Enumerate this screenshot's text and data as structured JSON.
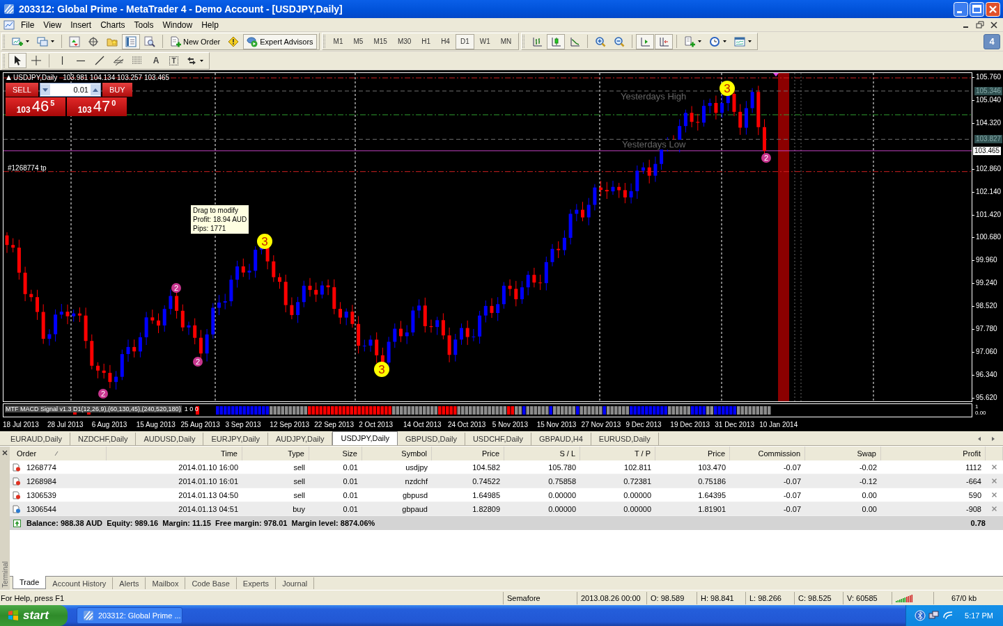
{
  "window": {
    "title": "203312: Global Prime - MetaTrader 4 - Demo Account - [USDJPY,Daily]"
  },
  "menu": [
    "File",
    "View",
    "Insert",
    "Charts",
    "Tools",
    "Window",
    "Help"
  ],
  "toolbar": {
    "main": [
      [
        {
          "kind": "new-chart",
          "pressed": false
        },
        {
          "kind": "profiles",
          "pressed": false
        }
      ],
      [
        {
          "kind": "market-watch",
          "pressed": false
        },
        {
          "kind": "data-window",
          "pressed": false
        },
        {
          "kind": "navigator",
          "pressed": false
        },
        {
          "kind": "terminal",
          "pressed": true
        },
        {
          "kind": "tester",
          "pressed": false
        }
      ],
      [
        {
          "kind": "new-order",
          "label": "New Order",
          "pressed": false
        },
        {
          "kind": "alert",
          "pressed": false
        },
        {
          "kind": "expert-advisors",
          "label": "Expert Advisors",
          "pressed": true
        }
      ]
    ],
    "timeframes": [
      {
        "label": "M1",
        "selected": false
      },
      {
        "label": "M5",
        "selected": false
      },
      {
        "label": "M15",
        "selected": false
      },
      {
        "label": "M30",
        "selected": false
      },
      {
        "label": "H1",
        "selected": false
      },
      {
        "label": "H4",
        "selected": false
      },
      {
        "label": "D1",
        "selected": true
      },
      {
        "label": "W1",
        "selected": false
      },
      {
        "label": "MN",
        "selected": false
      }
    ],
    "chart": [
      [
        {
          "kind": "bar-chart",
          "pressed": false
        },
        {
          "kind": "candles",
          "pressed": true
        },
        {
          "kind": "line-chart",
          "pressed": false
        }
      ],
      [
        {
          "kind": "zoom-in",
          "pressed": false
        },
        {
          "kind": "zoom-out",
          "pressed": false
        }
      ],
      [
        {
          "kind": "autoscroll",
          "pressed": true
        },
        {
          "kind": "chart-shift",
          "pressed": true
        }
      ],
      [
        {
          "kind": "indicators",
          "pressed": false
        },
        {
          "kind": "periods",
          "pressed": false
        },
        {
          "kind": "templates",
          "pressed": false
        }
      ]
    ],
    "drawing": [
      [
        {
          "kind": "cursor",
          "pressed": true
        },
        {
          "kind": "crosshair",
          "pressed": false
        }
      ],
      [
        {
          "kind": "vline",
          "pressed": false
        },
        {
          "kind": "hline",
          "pressed": false
        },
        {
          "kind": "trendline",
          "pressed": false
        },
        {
          "kind": "channel",
          "pressed": false
        },
        {
          "kind": "fibo",
          "pressed": false
        },
        {
          "kind": "text-tool",
          "label": "A",
          "pressed": false
        },
        {
          "kind": "label-tool",
          "label": "T",
          "pressed": false
        },
        {
          "kind": "arrows",
          "pressed": false
        }
      ]
    ]
  },
  "notifications": {
    "count": "4"
  },
  "chart": {
    "symbol": "USDJPY,Daily",
    "ohlc": "103.981 104.134 103.257 103.465",
    "one_click": {
      "sell": "SELL",
      "buy": "BUY",
      "lot": "0.01",
      "bid": {
        "prefix": "103",
        "big": "46",
        "sup": "5"
      },
      "ask": {
        "prefix": "103",
        "big": "47",
        "sup": "0"
      }
    },
    "order_label": "#1268774 tp",
    "tooltip": [
      "Drag to modify",
      "Profit: 18.94 AUD",
      "Pips: 1771"
    ],
    "level_labels": [
      "Yesterdays High",
      "Yesterdays Low"
    ],
    "markers": [
      {
        "label": "2",
        "kind": "minor",
        "color": "#c8358f"
      },
      {
        "label": "2",
        "kind": "minor",
        "color": "#c8358f"
      },
      {
        "label": "2",
        "kind": "minor",
        "color": "#c8358f"
      },
      {
        "label": "3",
        "kind": "major",
        "color": "#ffff00"
      },
      {
        "label": "3",
        "kind": "major",
        "color": "#ffff00"
      },
      {
        "label": "3",
        "kind": "major",
        "color": "#ffff00"
      },
      {
        "label": "2",
        "kind": "minor",
        "color": "#c8358f"
      }
    ],
    "price_ticks": [
      "105.760",
      "105.040",
      "104.320",
      "102.860",
      "102.140",
      "101.420",
      "100.680",
      "99.960",
      "99.240",
      "98.520",
      "97.780",
      "97.060",
      "96.340",
      "95.620"
    ],
    "price_tags": [
      {
        "label": "105.346",
        "kind": "level"
      },
      {
        "label": "103.827",
        "kind": "level"
      },
      {
        "label": "103.465",
        "kind": "bid"
      }
    ],
    "indicator": {
      "name": "MTF MACD Signal v1.3 D1(12,26,9),(60,130,45),(240,520,180)",
      "values": "1 0 0",
      "scale": [
        "1",
        "0.00"
      ]
    },
    "dates": [
      "18 Jul 2013",
      "28 Jul 2013",
      "6 Aug 2013",
      "15 Aug 2013",
      "25 Aug 2013",
      "3 Sep 2013",
      "12 Sep 2013",
      "22 Sep 2013",
      "2 Oct 2013",
      "14 Oct 2013",
      "24 Oct 2013",
      "5 Nov 2013",
      "15 Nov 2013",
      "27 Nov 2013",
      "9 Dec 2013",
      "19 Dec 2013",
      "31 Dec 2013",
      "10 Jan 2014"
    ]
  },
  "chart_tabs": [
    {
      "label": "EURAUD,Daily",
      "selected": false
    },
    {
      "label": "NZDCHF,Daily",
      "selected": false
    },
    {
      "label": "AUDUSD,Daily",
      "selected": false
    },
    {
      "label": "EURJPY,Daily",
      "selected": false
    },
    {
      "label": "AUDJPY,Daily",
      "selected": false
    },
    {
      "label": "USDJPY,Daily",
      "selected": true
    },
    {
      "label": "GBPUSD,Daily",
      "selected": false
    },
    {
      "label": "USDCHF,Daily",
      "selected": false
    },
    {
      "label": "GBPAUD,H4",
      "selected": false
    },
    {
      "label": "EURUSD,Daily",
      "selected": false
    }
  ],
  "terminal": {
    "label": "Terminal",
    "columns": [
      "Order",
      "Time",
      "Type",
      "Size",
      "Symbol",
      "Price",
      "S / L",
      "T / P",
      "Price",
      "Commission",
      "Swap",
      "Profit"
    ],
    "rows": [
      {
        "kind": "sell",
        "cells": [
          "1268774",
          "2014.01.10 16:00",
          "sell",
          "0.01",
          "usdjpy",
          "104.582",
          "105.780",
          "102.811",
          "103.470",
          "-0.07",
          "-0.02",
          "1112"
        ]
      },
      {
        "kind": "sell",
        "cells": [
          "1268984",
          "2014.01.10 16:01",
          "sell",
          "0.01",
          "nzdchf",
          "0.74522",
          "0.75858",
          "0.72381",
          "0.75186",
          "-0.07",
          "-0.12",
          "-664"
        ]
      },
      {
        "kind": "sell",
        "cells": [
          "1306539",
          "2014.01.13 04:50",
          "sell",
          "0.01",
          "gbpusd",
          "1.64985",
          "0.00000",
          "0.00000",
          "1.64395",
          "-0.07",
          "0.00",
          "590"
        ]
      },
      {
        "kind": "buy",
        "cells": [
          "1306544",
          "2014.01.13 04:51",
          "buy",
          "0.01",
          "gbpaud",
          "1.82809",
          "0.00000",
          "0.00000",
          "1.81901",
          "-0.07",
          "0.00",
          "-908"
        ]
      }
    ],
    "summary": {
      "text": "Balance: 988.38 AUD  Equity: 989.16  Margin: 11.15  Free margin: 978.01  Margin level: 8874.06%",
      "profit": "0.78"
    },
    "tabs": [
      {
        "label": "Trade",
        "selected": true
      },
      {
        "label": "Account History",
        "selected": false
      },
      {
        "label": "Alerts",
        "selected": false
      },
      {
        "label": "Mailbox",
        "selected": false
      },
      {
        "label": "Code Base",
        "selected": false
      },
      {
        "label": "Experts",
        "selected": false
      },
      {
        "label": "Journal",
        "selected": false
      }
    ]
  },
  "status_bar": {
    "help": "For Help, press F1",
    "indicator": "Semafore",
    "time": "2013.08.26 00:00",
    "open": "O: 98.589",
    "high": "H: 98.841",
    "low": "L: 98.266",
    "close": "C: 98.525",
    "volume": "V: 60585",
    "traffic": "67/0 kb"
  },
  "taskbar": {
    "start": "start",
    "task": "203312: Global Prime ...",
    "clock": "5:17 PM"
  }
}
